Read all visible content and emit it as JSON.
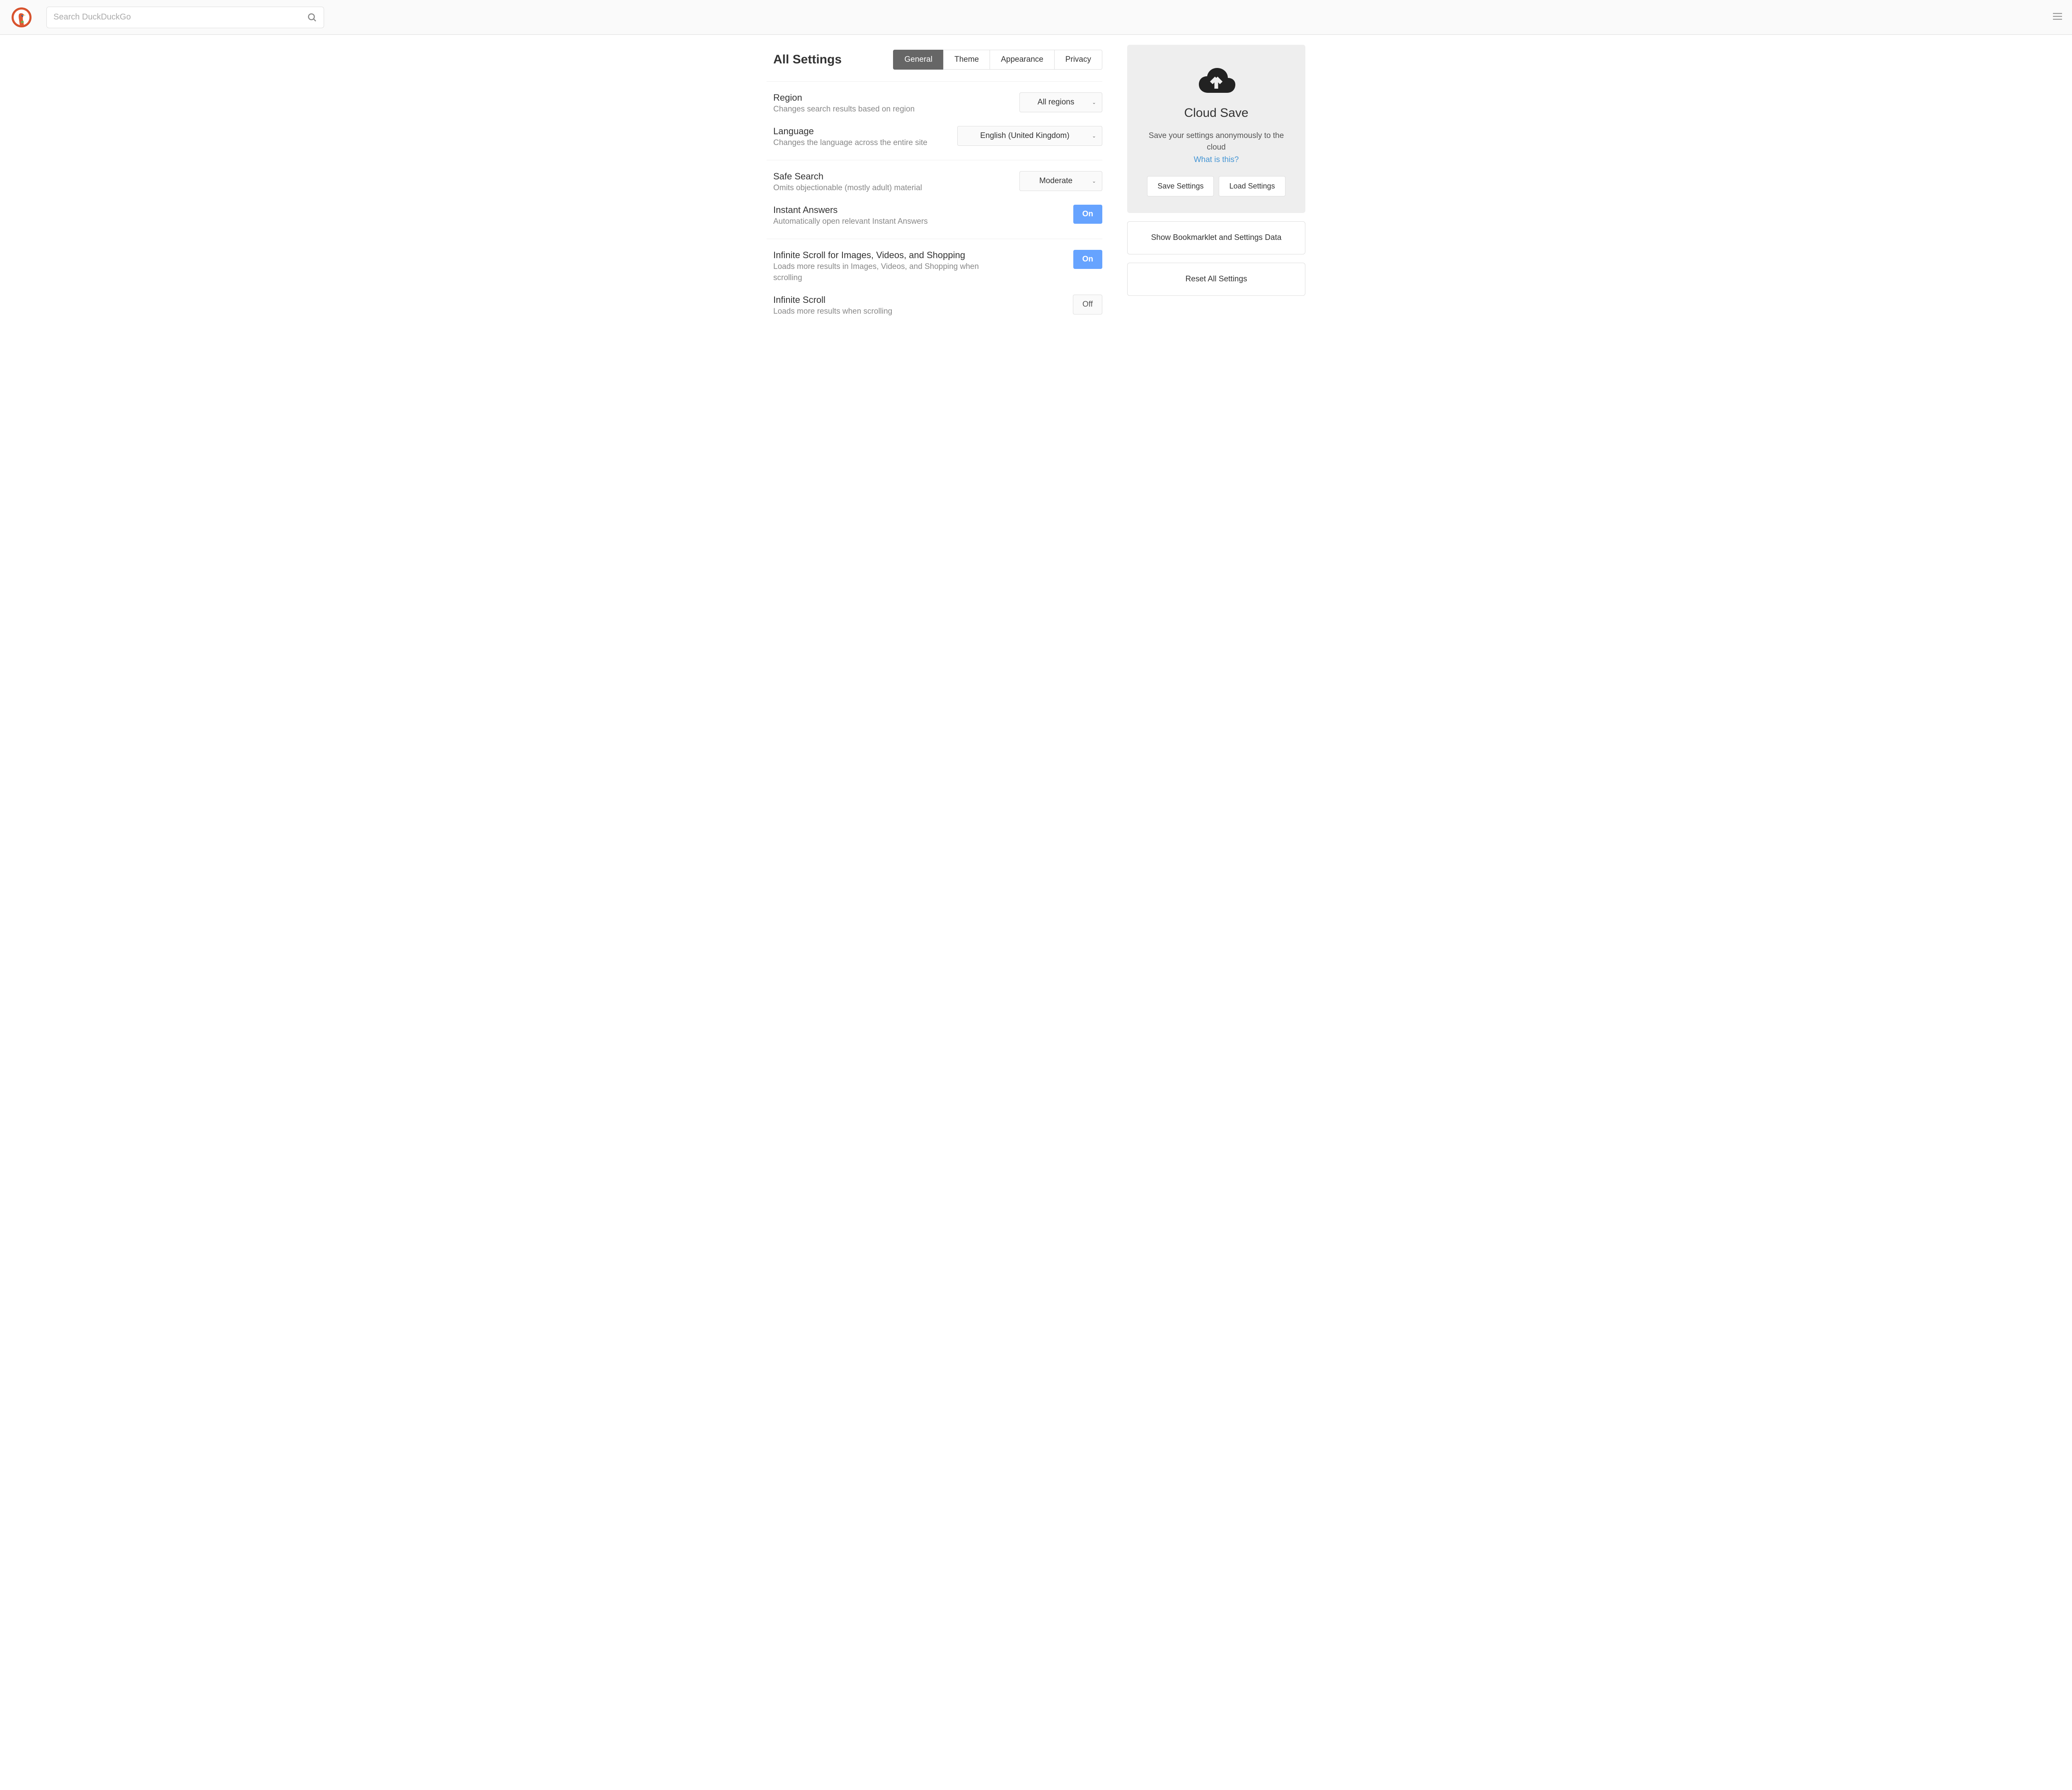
{
  "header": {
    "search_placeholder": "Search DuckDuckGo"
  },
  "page_title": "All Settings",
  "tabs": [
    {
      "label": "General"
    },
    {
      "label": "Theme"
    },
    {
      "label": "Appearance"
    },
    {
      "label": "Privacy"
    }
  ],
  "settings": {
    "region": {
      "title": "Region",
      "desc": "Changes search results based on region",
      "value": "All regions"
    },
    "language": {
      "title": "Language",
      "desc": "Changes the language across the entire site",
      "value": "English (United Kingdom)"
    },
    "safe_search": {
      "title": "Safe Search",
      "desc": "Omits objectionable (mostly adult) material",
      "value": "Moderate"
    },
    "instant_answers": {
      "title": "Instant Answers",
      "desc": "Automatically open relevant Instant Answers",
      "value": "On"
    },
    "infinite_media": {
      "title": "Infinite Scroll for Images, Videos, and Shopping",
      "desc": "Loads more results in Images, Videos, and Shopping when scrolling",
      "value": "On"
    },
    "infinite_scroll": {
      "title": "Infinite Scroll",
      "desc": "Loads more results when scrolling",
      "value": "Off"
    }
  },
  "cloud": {
    "title": "Cloud Save",
    "desc": "Save your settings anonymously to the cloud",
    "link": "What is this?",
    "save_label": "Save Settings",
    "load_label": "Load Settings"
  },
  "side": {
    "bookmarklet": "Show Bookmarklet and Settings Data",
    "reset": "Reset All Settings"
  }
}
